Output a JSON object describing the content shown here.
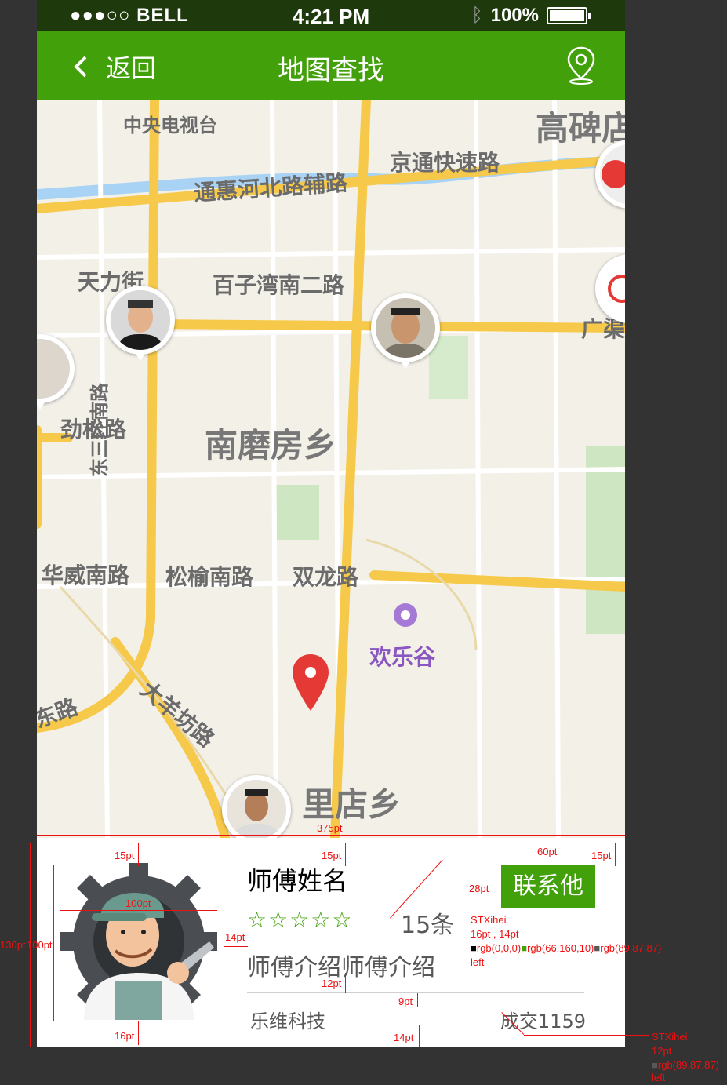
{
  "status_bar": {
    "carrier": "●●●○○ BELL",
    "time": "4:21 PM",
    "battery": "100%"
  },
  "nav": {
    "back_label": "返回",
    "title": "地图查找"
  },
  "map": {
    "labels": [
      "中央电视台",
      "高碑店",
      "京通快速路",
      "通惠河北路辅路",
      "天力街",
      "百子湾南二路",
      "广渠",
      "劲松路",
      "南磨房乡",
      "东三环南路",
      "华威南路",
      "松榆南路",
      "双龙路",
      "欢乐谷",
      "大羊坊路",
      "里店乡",
      "东路"
    ]
  },
  "card": {
    "name": "师傅姓名",
    "stars": "☆☆☆☆☆",
    "reviews": "15条",
    "intro": "师傅介绍师傅介绍",
    "company": "乐维科技",
    "deals": "成交1159",
    "contact_label": "联系他"
  },
  "colors": {
    "brand_green": "#42a00a",
    "text_black": "#000000",
    "text_gray": "#595757",
    "annotation_red": "#e11111"
  },
  "annotations": {
    "width_total": "375pt",
    "top_pad_left": "15pt",
    "top_pad_mid": "15pt",
    "btn_width": "60pt",
    "right_pad": "15pt",
    "btn_height": "28pt",
    "avatar_size": "100pt",
    "gap": "14pt",
    "card_height": "130pt",
    "inner_height": "100pt",
    "font_note_1": "STXihei",
    "font_note_2": "16pt , 14pt",
    "color_note_1": "rgb(0,0,0)",
    "color_note_2": "rgb(66,160,10)",
    "color_note_3": "rgb(89,87,87)",
    "align_note": "left",
    "gap_12": "12pt",
    "gap_9": "9pt",
    "bottom_pad_left": "16pt",
    "bottom_pad_mid": "14pt",
    "font_note_3": "STXihei",
    "font_note_4": "12pt",
    "color_note_4": "rgb(89,87,87)",
    "align_note_2": "left"
  }
}
